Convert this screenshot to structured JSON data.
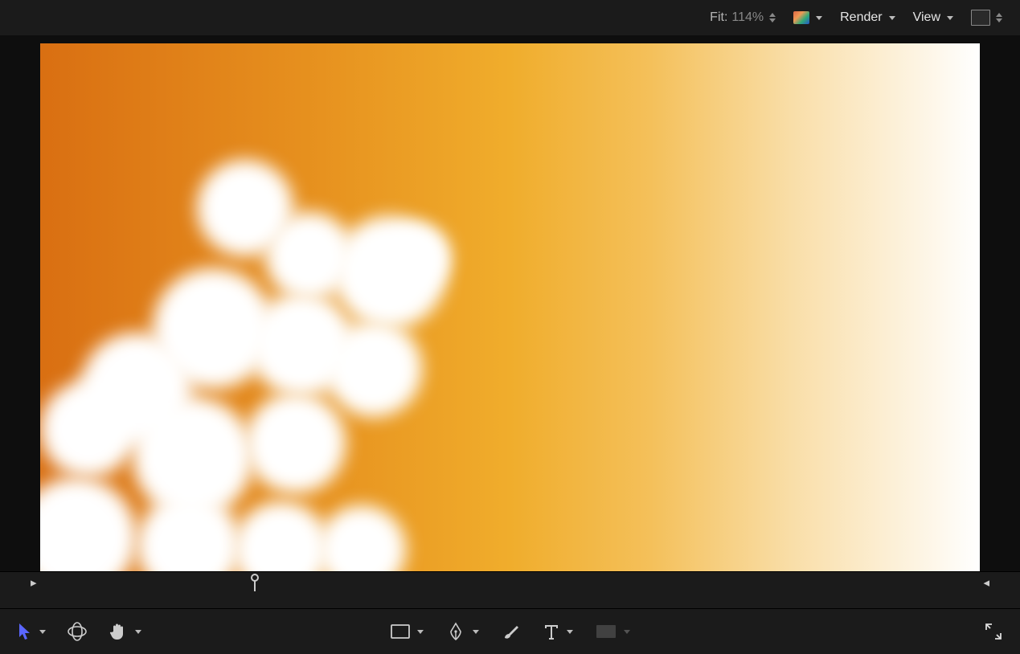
{
  "topbar": {
    "fit_label": "Fit:",
    "fit_value": "114%",
    "color_menu": "color-channels",
    "render_label": "Render",
    "view_label": "View",
    "layout_icon": "layout-single"
  },
  "timeline": {
    "in_marker": "in",
    "out_marker": "out",
    "playhead_pct": 23
  },
  "tools": {
    "select": "select-tool",
    "orbit": "orbit-3d-tool",
    "pan": "pan-hand-tool",
    "rect": "rectangle-tool",
    "pen": "pen-bezier-tool",
    "brush": "paint-brush-tool",
    "text": "text-tool",
    "mask": "mask-tool",
    "expand": "expand-fullscreen"
  },
  "colors": {
    "select_tool": "#5a66ff"
  }
}
